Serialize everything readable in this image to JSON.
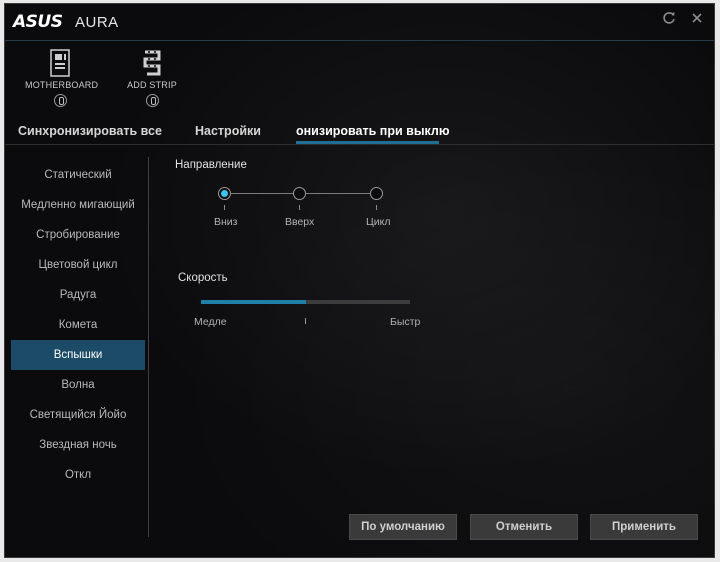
{
  "window": {
    "logo": "ASUS",
    "title": "AURA",
    "refresh_icon": "refresh-icon",
    "close_icon": "close-icon"
  },
  "devices": [
    {
      "label": "MOTHERBOARD",
      "icon": "motherboard-icon"
    },
    {
      "label": "ADD STRIP",
      "icon": "led-strip-icon"
    }
  ],
  "tabs": [
    {
      "label": "Синхронизировать все",
      "active": false
    },
    {
      "label": "Настройки",
      "active": false
    },
    {
      "label": "онизировать при выклю",
      "active": true
    }
  ],
  "sidebar": {
    "items": [
      {
        "label": "Статический"
      },
      {
        "label": "Медленно мигающий"
      },
      {
        "label": "Стробирование"
      },
      {
        "label": "Цветовой цикл"
      },
      {
        "label": "Радуга"
      },
      {
        "label": "Комета"
      },
      {
        "label": "Вспышки",
        "active": true
      },
      {
        "label": "Волна"
      },
      {
        "label": "Светящийся Йойо"
      },
      {
        "label": "Звездная ночь"
      },
      {
        "label": "Откл"
      }
    ]
  },
  "direction": {
    "title": "Направление",
    "options": [
      "Вниз",
      "Вверх",
      "Цикл"
    ],
    "selected": "Вниз"
  },
  "speed": {
    "title": "Скорость",
    "min_label": "Медле",
    "max_label": "Быстр",
    "value_fraction": 0.5
  },
  "buttons": {
    "default": "По умолчанию",
    "cancel": "Отменить",
    "apply": "Применить"
  },
  "colors": {
    "accent": "#1f6e93",
    "selected_bg": "#1c4b67",
    "node_selected": "#3ec4f0"
  }
}
